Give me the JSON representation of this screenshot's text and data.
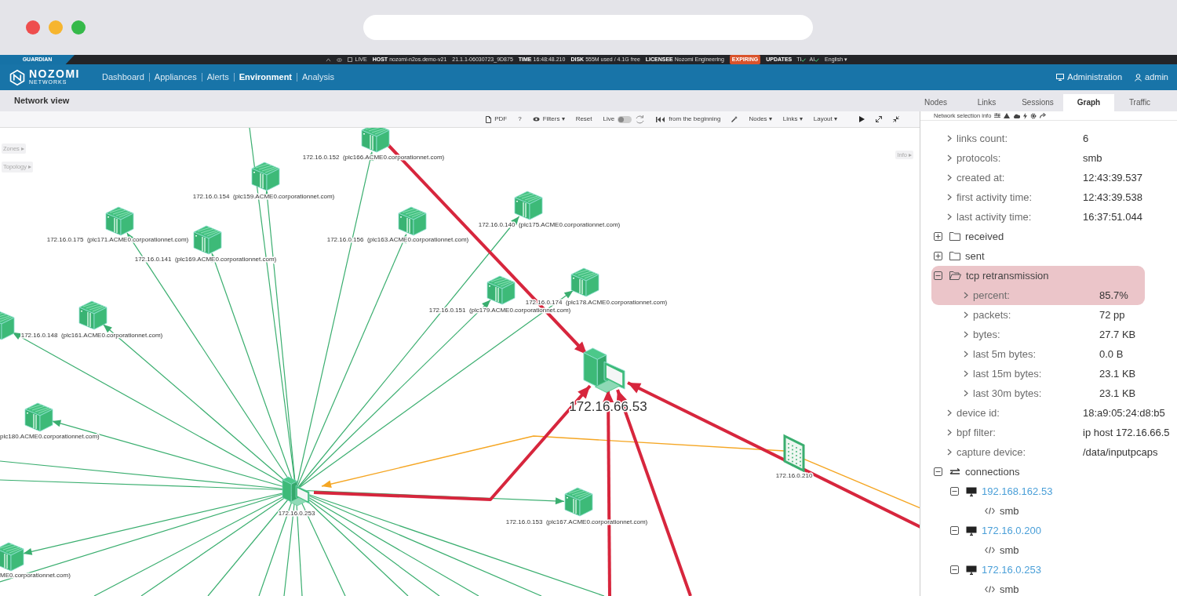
{
  "app": {
    "product": "GUARDIAN"
  },
  "status_bar": [
    {
      "kind": "live",
      "value": "LIVE"
    },
    {
      "kind": "pair",
      "label": "HOST",
      "value": "nozomi-n2os.demo-v21"
    },
    {
      "kind": "plain",
      "value": "21.1.1-06030723_9D875"
    },
    {
      "kind": "pair",
      "label": "TIME",
      "value": "16:48:48.210"
    },
    {
      "kind": "pair",
      "label": "DISK",
      "value": "555M used / 4.1G free"
    },
    {
      "kind": "pair",
      "label": "LICENSEE",
      "value": "Nozomi Engineering"
    },
    {
      "kind": "badge",
      "value": "EXPIRING"
    },
    {
      "kind": "checks",
      "label": "UPDATES",
      "items": [
        "TI",
        "AI"
      ]
    },
    {
      "kind": "menu",
      "value": "English ▾"
    }
  ],
  "nav": {
    "logo": {
      "name": "NOZOMI",
      "tagline": "NETWORKS"
    },
    "items": [
      {
        "label": "Dashboard",
        "selected": false
      },
      {
        "label": "Appliances",
        "selected": false
      },
      {
        "label": "Alerts",
        "selected": false
      },
      {
        "label": "Environment",
        "selected": true
      },
      {
        "label": "Analysis",
        "selected": false
      }
    ],
    "right": [
      {
        "kind": "admin",
        "label": "Administration"
      },
      {
        "kind": "user",
        "label": "admin"
      }
    ]
  },
  "view": {
    "title": "Network view",
    "tabs": [
      {
        "label": "Nodes",
        "selected": false
      },
      {
        "label": "Links",
        "selected": false
      },
      {
        "label": "Sessions",
        "selected": false
      },
      {
        "label": "Graph",
        "selected": true
      },
      {
        "label": "Traffic",
        "selected": false
      }
    ]
  },
  "toolbar": [
    {
      "kind": "pdf",
      "label": "PDF"
    },
    {
      "kind": "text",
      "label": "?"
    },
    {
      "kind": "filters",
      "label": "Filters ▾"
    },
    {
      "kind": "text",
      "label": "Reset"
    },
    {
      "kind": "live",
      "label": "Live",
      "on": false
    },
    {
      "kind": "replay",
      "label": "from the beginning"
    },
    {
      "kind": "wand"
    },
    {
      "kind": "text",
      "label": "Nodes ▾"
    },
    {
      "kind": "text",
      "label": "Links ▾"
    },
    {
      "kind": "text",
      "label": "Layout ▾"
    },
    {
      "kind": "play"
    },
    {
      "kind": "expand"
    },
    {
      "kind": "compress"
    }
  ],
  "graph": {
    "left_panels": [
      {
        "label": "Zones ▸"
      },
      {
        "label": "Topology ▸"
      }
    ],
    "right_panels": [
      {
        "label": "Info ▸"
      }
    ],
    "nodes": [
      {
        "kind": "plc",
        "label": "172.16.0.152  (plc166.ACME0.corporationnet.com)",
        "selected": false
      },
      {
        "kind": "plc",
        "label": "172.16.0.154  (plc159.ACME0.corporationnet.com)",
        "selected": false
      },
      {
        "kind": "plc",
        "label": "172.16.0.175  (plc171.ACME0.corporationnet.com)",
        "selected": false
      },
      {
        "kind": "plc",
        "label": "172.16.0.141  (plc169.ACME0.corporationnet.com)",
        "selected": false
      },
      {
        "kind": "plc",
        "label": "172.16.0.156  (plc163.ACME0.corporationnet.com)",
        "selected": false
      },
      {
        "kind": "plc",
        "label": "172.16.0.140  (plc175.ACME0.corporationnet.com)",
        "selected": false
      },
      {
        "kind": "plc",
        "label": "172.16.0.151  (plc179.ACME0.corporationnet.com)",
        "selected": false
      },
      {
        "kind": "plc",
        "label": "172.16.0.174  (plc178.ACME0.corporationnet.com)",
        "selected": false
      },
      {
        "kind": "plc",
        "label": "172.16.0.148  (plc161.ACME0.corporationnet.com)",
        "selected": false
      },
      {
        "kind": "plc",
        "label": "plc180.ACME0.corporationnet.com)",
        "selected": false
      },
      {
        "kind": "plc",
        "label": "ME0.corporationnet.com)",
        "selected": false
      },
      {
        "kind": "plc",
        "selected": false
      },
      {
        "kind": "plc",
        "label": "172.16.0.153  (plc167.ACME0.corporationnet.com)",
        "selected": false
      },
      {
        "kind": "computer",
        "label": "172.16.0.253",
        "selected": false
      },
      {
        "kind": "computer",
        "label": "172.16.66.53",
        "selected": true
      },
      {
        "kind": "panel",
        "label": "172.16.0.210",
        "selected": false
      }
    ]
  },
  "info_panel": {
    "title": "Network selection info",
    "tree": [
      {
        "kind": "field",
        "label": "links count:",
        "value": "6",
        "highlighted": false
      },
      {
        "kind": "field",
        "label": "protocols:",
        "value": "smb",
        "highlighted": false
      },
      {
        "kind": "field",
        "label": "created at:",
        "value": "12:43:39.537",
        "highlighted": false
      },
      {
        "kind": "field",
        "label": "first activity time:",
        "value": "12:43:39.538",
        "highlighted": false
      },
      {
        "kind": "field",
        "label": "last activity time:",
        "value": "16:37:51.044",
        "highlighted": false
      },
      {
        "kind": "folder",
        "label": "received",
        "expanded": false,
        "highlighted": false
      },
      {
        "kind": "folder",
        "label": "sent",
        "expanded": false,
        "highlighted": false
      },
      {
        "kind": "folder",
        "label": "tcp retransmission",
        "expanded": true,
        "highlighted": true,
        "children": [
          {
            "kind": "field",
            "label": "percent:",
            "value": "85.7%",
            "highlighted": true
          },
          {
            "kind": "field",
            "label": "packets:",
            "value": "72 pp",
            "highlighted": false
          },
          {
            "kind": "field",
            "label": "bytes:",
            "value": "27.7 KB",
            "highlighted": false
          },
          {
            "kind": "field",
            "label": "last 5m bytes:",
            "value": "0.0 B",
            "highlighted": false
          },
          {
            "kind": "field",
            "label": "last 15m bytes:",
            "value": "23.1 KB",
            "highlighted": false
          },
          {
            "kind": "field",
            "label": "last 30m bytes:",
            "value": "23.1 KB",
            "highlighted": false
          }
        ]
      },
      {
        "kind": "field",
        "label": "device id:",
        "value": "18:a9:05:24:d8:b5",
        "highlighted": false
      },
      {
        "kind": "field",
        "label": "bpf filter:",
        "value": "ip host 172.16.66.5",
        "highlighted": false
      },
      {
        "kind": "field",
        "label": "capture device:",
        "value": "/data/inputpcaps",
        "highlighted": false
      },
      {
        "kind": "group",
        "label": "connections",
        "expanded": true,
        "highlighted": false,
        "children": [
          {
            "kind": "host",
            "label": "192.168.162.53",
            "expanded": true,
            "children": [
              {
                "kind": "protocol",
                "label": "smb"
              }
            ]
          },
          {
            "kind": "host",
            "label": "172.16.0.200",
            "expanded": true,
            "children": [
              {
                "kind": "protocol",
                "label": "smb"
              }
            ]
          },
          {
            "kind": "host",
            "label": "172.16.0.253",
            "expanded": true,
            "children": [
              {
                "kind": "protocol",
                "label": "smb"
              }
            ]
          }
        ]
      }
    ]
  }
}
